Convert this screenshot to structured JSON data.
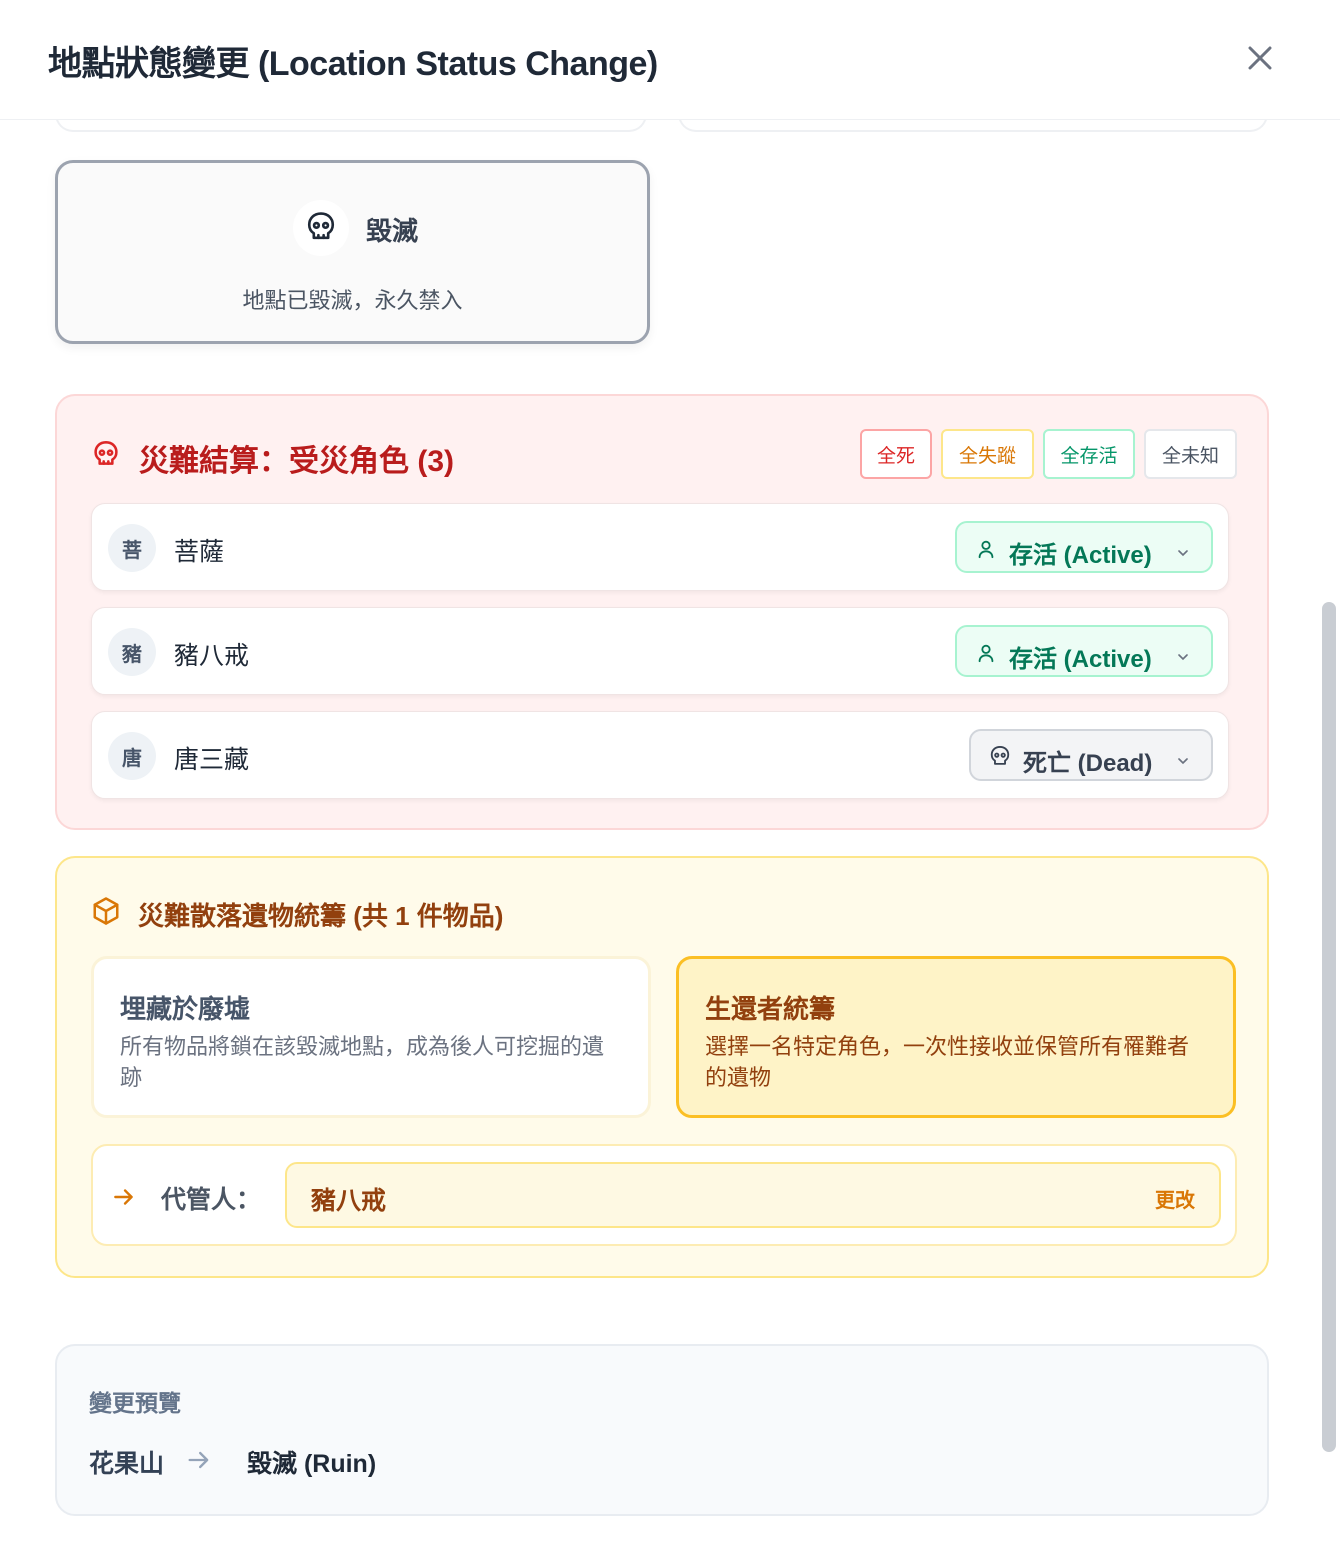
{
  "header": {
    "title": "地點狀態變更 (Location Status Change)",
    "close_icon": "close-icon"
  },
  "status_option": {
    "icon": "skull-icon",
    "label": "毀滅",
    "description": "地點已毀滅，永久禁入"
  },
  "disaster": {
    "icon": "skull-icon",
    "title": "災難結算：受災角色 (3)",
    "bulk_actions": [
      "全死",
      "全失蹤",
      "全存活",
      "全未知"
    ],
    "characters": [
      {
        "avatar": "菩",
        "name": "菩薩",
        "state": "存活 (Active)",
        "state_icon": "user-icon"
      },
      {
        "avatar": "豬",
        "name": "豬八戒",
        "state": "存活 (Active)",
        "state_icon": "user-icon"
      },
      {
        "avatar": "唐",
        "name": "唐三藏",
        "state": "死亡 (Dead)",
        "state_icon": "skull-icon"
      }
    ]
  },
  "relics": {
    "icon": "package-icon",
    "title": "災難散落遺物統籌 (共 1 件物品)",
    "options": [
      {
        "title": "埋藏於廢墟",
        "description": "所有物品將鎖在該毀滅地點，成為後人可挖掘的遺跡",
        "selected": false
      },
      {
        "title": "生還者統籌",
        "description": "選擇一名特定角色，一次性接收並保管所有罹難者的遺物",
        "selected": true
      }
    ],
    "custodian": {
      "label": "代管人：",
      "value": "豬八戒",
      "change_label": "更改"
    }
  },
  "preview": {
    "title": "變更預覽",
    "from": "花果山",
    "to": "毀滅 (Ruin)"
  }
}
